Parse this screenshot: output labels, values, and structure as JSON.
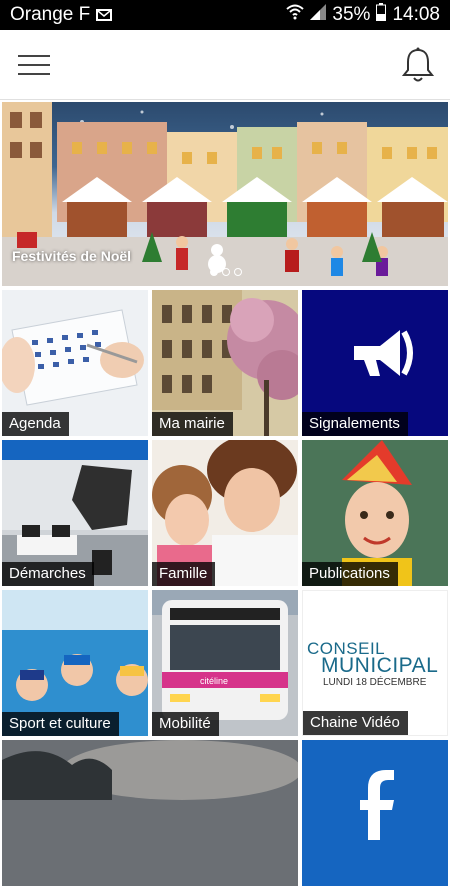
{
  "status_bar": {
    "carrier": "Orange F",
    "battery": "35%",
    "time": "14:08"
  },
  "banner": {
    "title": "Festivités de Noël",
    "slide_count": 3,
    "active_slide": 1
  },
  "tiles": [
    {
      "label": "Agenda",
      "color": "#e9edf1"
    },
    {
      "label": "Ma mairie",
      "color": "#b9a57a"
    },
    {
      "label": "Signalements",
      "color": "#06087e"
    },
    {
      "label": "Démarches",
      "color": "#b7bcc2"
    },
    {
      "label": "Famille",
      "color": "#c99e7e"
    },
    {
      "label": "Publications",
      "color": "#3f6a52"
    },
    {
      "label": "Sport et culture",
      "color": "#3a98d4"
    },
    {
      "label": "Mobilité",
      "color": "#c7bfb4"
    },
    {
      "label": "Chaine Vidéo",
      "color": "#ffffff"
    },
    {
      "label": "",
      "color": "#6b6f74"
    },
    {
      "label": "",
      "color": "#1565c0"
    }
  ],
  "video_tile": {
    "line1": "CONSEIL",
    "line2": "MUNICIPAL",
    "line3": "LUNDI 18 DÉCEMBRE"
  },
  "bus": {
    "brand": "citéline"
  }
}
